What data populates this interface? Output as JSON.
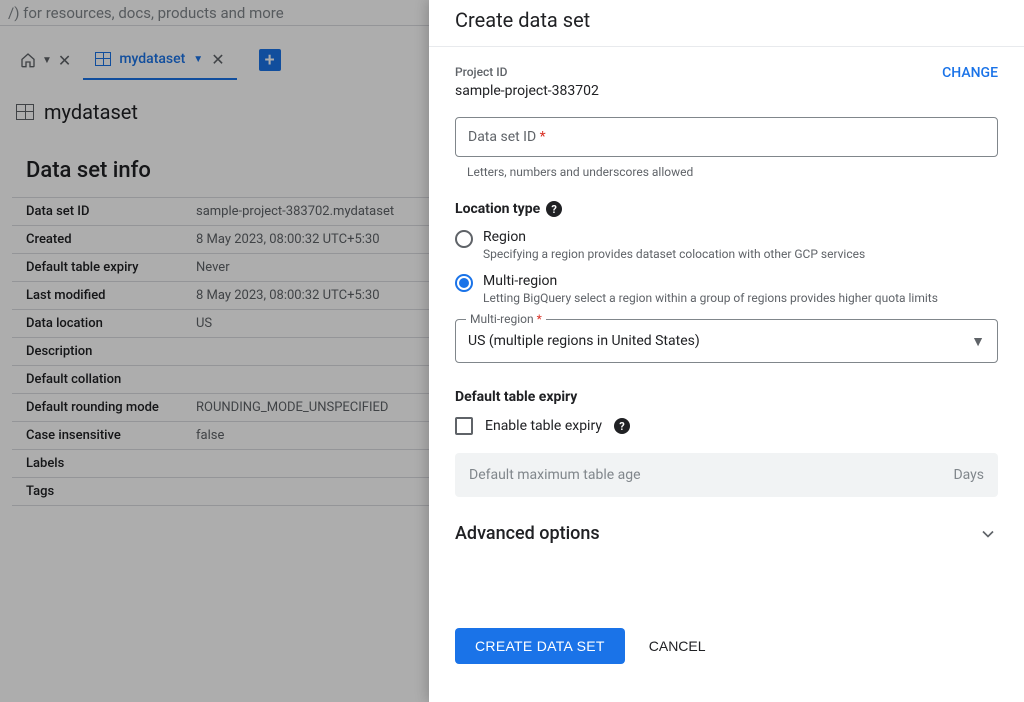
{
  "search": {
    "placeholder": "/) for resources, docs, products and more"
  },
  "tabs": {
    "activeName": "mydataset"
  },
  "page": {
    "title": "mydataset"
  },
  "infoSection": {
    "title": "Data set info"
  },
  "infoRows": [
    {
      "label": "Data set ID",
      "value": "sample-project-383702.mydataset"
    },
    {
      "label": "Created",
      "value": "8 May 2023, 08:00:32 UTC+5:30"
    },
    {
      "label": "Default table expiry",
      "value": "Never"
    },
    {
      "label": "Last modified",
      "value": "8 May 2023, 08:00:32 UTC+5:30"
    },
    {
      "label": "Data location",
      "value": "US"
    },
    {
      "label": "Description",
      "value": ""
    },
    {
      "label": "Default collation",
      "value": ""
    },
    {
      "label": "Default rounding mode",
      "value": "ROUNDING_MODE_UNSPECIFIED"
    },
    {
      "label": "Case insensitive",
      "value": "false"
    },
    {
      "label": "Labels",
      "value": ""
    },
    {
      "label": "Tags",
      "value": ""
    }
  ],
  "panel": {
    "title": "Create data set",
    "projectIdLabel": "Project ID",
    "projectId": "sample-project-383702",
    "change": "CHANGE",
    "datasetIdPlaceholder": "Data set ID",
    "datasetIdHelper": "Letters, numbers and underscores allowed",
    "locationTypeLabel": "Location type",
    "regionOption": {
      "label": "Region",
      "sub": "Specifying a region provides dataset colocation with other GCP services"
    },
    "multiRegionOption": {
      "label": "Multi-region",
      "sub": "Letting BigQuery select a region within a group of regions provides higher quota limits"
    },
    "multiRegionSelect": {
      "label": "Multi-region",
      "value": "US (multiple regions in United States)"
    },
    "expirySection": "Default table expiry",
    "enableExpiryLabel": "Enable table expiry",
    "maxAgePlaceholder": "Default maximum table age",
    "daysSuffix": "Days",
    "advanced": "Advanced options",
    "createBtn": "CREATE DATA SET",
    "cancelBtn": "CANCEL"
  }
}
